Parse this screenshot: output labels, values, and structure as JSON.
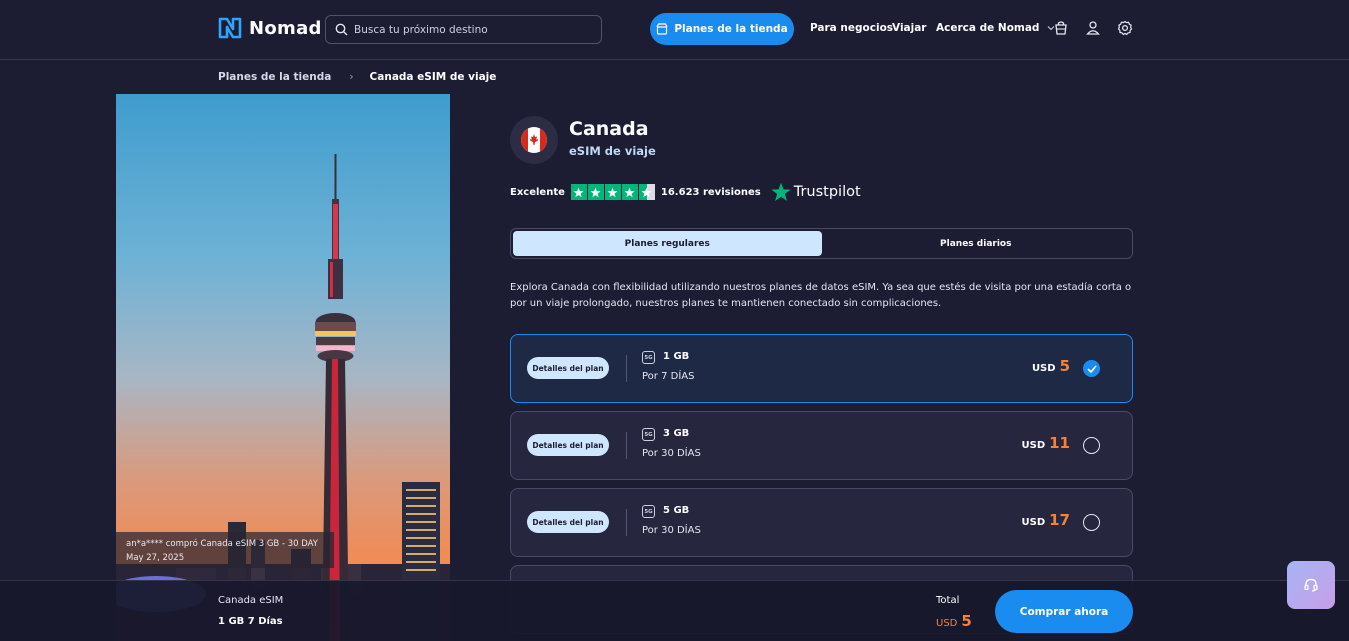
{
  "header": {
    "logo_text": "Nomad",
    "search_placeholder": "Busca tu próximo destino",
    "store_button": "Planes de la tienda",
    "nav": [
      "Para negocios",
      "Viajar",
      "Acerca de Nomad"
    ]
  },
  "breadcrumb": {
    "parent": "Planes de la tienda",
    "separator": "›",
    "current": "Canada eSIM de viaje"
  },
  "hero": {
    "toast_line1": "an*a**** compró Canada eSIM 3 GB - 30 DAY",
    "toast_line2": "May 27, 2025"
  },
  "product": {
    "country": "Canada",
    "subtitle": "eSIM de viaje",
    "rating_label": "Excelente",
    "rating_stars": 4.5,
    "reviews": "16.623 revisiones",
    "trustpilot": "Trustpilot"
  },
  "tabs": [
    {
      "label": "Planes regulares",
      "active": true
    },
    {
      "label": "Planes diarios",
      "active": false
    }
  ],
  "description": "Explora Canada con flexibilidad utilizando nuestros planes de datos eSIM. Ya sea que estés de visita por una estadía corta o por un viaje prolongado, nuestros planes te mantienen conectado sin complicaciones.",
  "plans": [
    {
      "detail_label": "Detalles del plan",
      "network": "5G",
      "data": "1 GB",
      "duration": "Por 7 DÍAS",
      "currency": "USD",
      "price": "5",
      "selected": true
    },
    {
      "detail_label": "Detalles del plan",
      "network": "5G",
      "data": "3 GB",
      "duration": "Por 30 DÍAS",
      "currency": "USD",
      "price": "11",
      "selected": false
    },
    {
      "detail_label": "Detalles del plan",
      "network": "5G",
      "data": "5 GB",
      "duration": "Por 30 DÍAS",
      "currency": "USD",
      "price": "17",
      "selected": false
    }
  ],
  "bottom_bar": {
    "product_name": "Canada eSIM",
    "plan_summary": "1 GB 7 Días",
    "total_label": "Total",
    "total_currency": "USD",
    "total_value": "5",
    "buy_button": "Comprar ahora"
  },
  "colors": {
    "background": "#1c1c33",
    "accent": "#1a8cf0",
    "price": "#f5813a",
    "trustpilot_green": "#00b67a"
  }
}
